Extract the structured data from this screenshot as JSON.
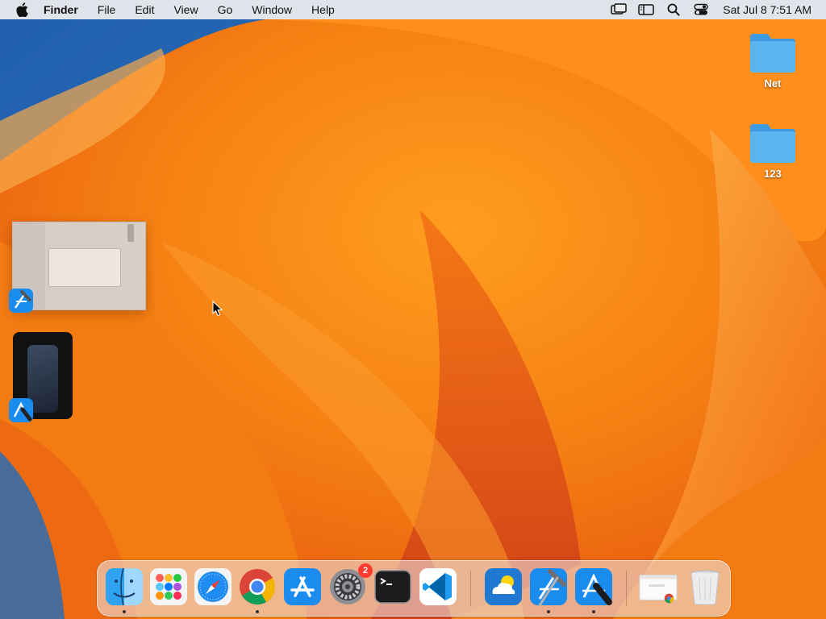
{
  "menubar": {
    "app_name": "Finder",
    "menus": [
      "File",
      "Edit",
      "View",
      "Go",
      "Window",
      "Help"
    ],
    "clock": "Sat Jul 8  7:51 AM",
    "status_icons": [
      "screen-mirroring-icon",
      "sidebar-icon",
      "search-icon",
      "control-center-icon"
    ]
  },
  "desktop": {
    "folders": [
      {
        "name": "Net"
      },
      {
        "name": "123"
      }
    ],
    "minimized_windows": [
      {
        "app": "Xcode"
      },
      {
        "app": "Simulator"
      }
    ]
  },
  "dock": {
    "apps": [
      {
        "name": "Finder",
        "icon": "finder-icon",
        "running": true
      },
      {
        "name": "Launchpad",
        "icon": "launchpad-icon",
        "running": false
      },
      {
        "name": "Safari",
        "icon": "safari-icon",
        "running": false
      },
      {
        "name": "Google Chrome",
        "icon": "chrome-icon",
        "running": true
      },
      {
        "name": "App Store",
        "icon": "app-store-icon",
        "running": false
      },
      {
        "name": "System Settings",
        "icon": "settings-icon",
        "running": false,
        "badge": "2"
      },
      {
        "name": "Terminal",
        "icon": "terminal-icon",
        "running": false
      },
      {
        "name": "Visual Studio Code",
        "icon": "vscode-icon",
        "running": false
      },
      {
        "name": "Weather",
        "icon": "weather-icon",
        "running": false
      },
      {
        "name": "Xcode",
        "icon": "xcode-icon",
        "running": true
      },
      {
        "name": "Simulator",
        "icon": "simulator-icon",
        "running": true
      }
    ],
    "extras": [
      {
        "name": "Chrome window",
        "icon": "chrome-window-icon"
      },
      {
        "name": "Trash",
        "icon": "trash-icon"
      }
    ]
  },
  "colors": {
    "folder_blue": "#5ab4f0",
    "wallpaper_orange": "#f7941d",
    "wallpaper_blue": "#2a6cb4",
    "badge_red": "#ff3b30"
  }
}
